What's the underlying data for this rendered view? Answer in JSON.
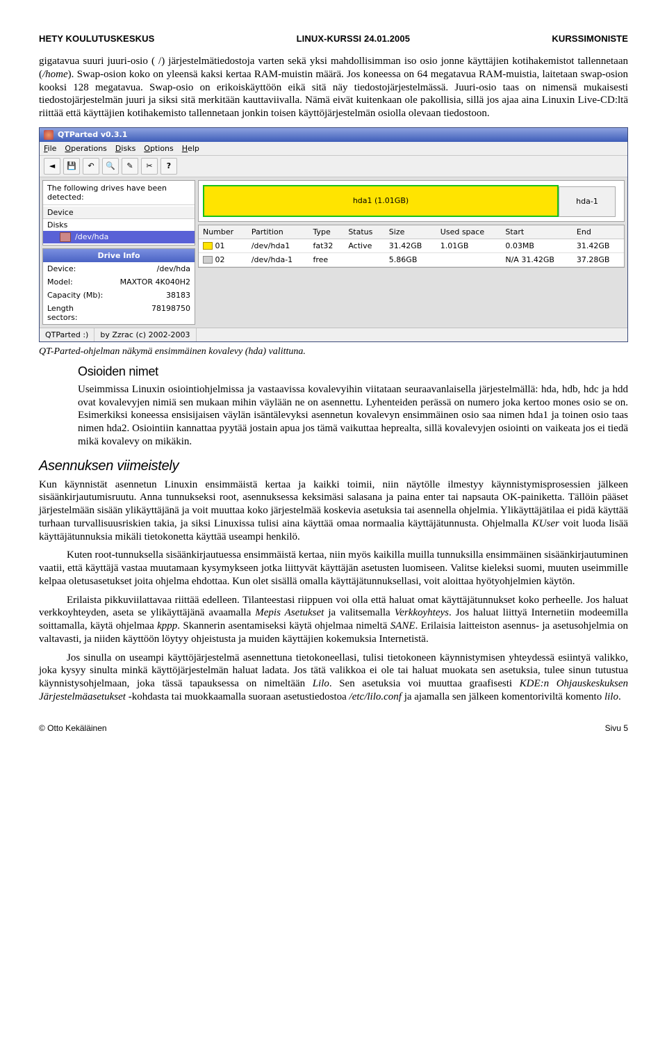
{
  "header": {
    "left": "HETY KOULUTUSKESKUS",
    "center": "LINUX-KURSSI 24.01.2005",
    "right": "KURSSIMONISTE"
  },
  "para1_html": "gigatavua suuri juuri-osio ( /) järjestelmätiedostoja varten sekä yksi mahdollisimman iso osio jonne käyttäjien kotihakemistot tallennetaan (<em>/home</em>). Swap-osion koko on yleensä kaksi kertaa RAM-muistin määrä. Jos koneessa on 64 megatavua RAM-muistia, laitetaan swap-osion kooksi 128 megatavua. Swap-osio on erikoiskäyttöön eikä sitä näy tiedostojärjestelmässä. Juuri-osio taas on nimensä mukaisesti tiedostojärjestelmän juuri ja siksi sitä merkitään kauttaviivalla. Nämä eivät kuitenkaan ole pakollisia, sillä jos ajaa aina Linuxin Live-CD:ltä riittää että käyttäjien kotihakemisto tallennetaan jonkin toisen käyttöjärjestelmän osiolla olevaan tiedostoon.",
  "screenshot": {
    "title": "QTParted v0.3.1",
    "menu": [
      "File",
      "Operations",
      "Disks",
      "Options",
      "Help"
    ],
    "toolbar_icons": [
      "arrow-left-icon",
      "save-icon",
      "undo-icon",
      "magnifier-icon",
      "pencil-icon",
      "cut-icon",
      "help-icon"
    ],
    "detect_label": "The following drives have been detected:",
    "tree_header": "Device",
    "tree_group": "Disks",
    "tree_item": "/dev/hda",
    "drive_info_title": "Drive Info",
    "drive_info": [
      {
        "k": "Device:",
        "v": "/dev/hda"
      },
      {
        "k": "Model:",
        "v": "MAXTOR 4K040H2"
      },
      {
        "k": "Capacity (Mb):",
        "v": "38183"
      },
      {
        "k": "Length sectors:",
        "v": "78198750"
      }
    ],
    "part_bar_label": "hda1 (1.01GB)",
    "part_bar_right": "hda-1",
    "table_headers": [
      "Number",
      "Partition",
      "Type",
      "Status",
      "Size",
      "Used space",
      "Start",
      "End"
    ],
    "table_rows": [
      {
        "icon": "flag-fat",
        "cells": [
          "01",
          "/dev/hda1",
          "fat32",
          "Active",
          "31.42GB",
          "1.01GB",
          "0.03MB",
          "31.42GB"
        ]
      },
      {
        "icon": "flag-free",
        "cells": [
          "02",
          "/dev/hda-1",
          "free",
          "",
          "5.86GB",
          "",
          "N/A 31.42GB",
          "37.28GB"
        ]
      }
    ],
    "statusbar": [
      "QTParted :)",
      "by Zzrac (c) 2002-2003"
    ]
  },
  "caption": "QT-Parted-ohjelman näkymä ensimmäinen kovalevy (hda) valittuna.",
  "sub1": "Osioiden nimet",
  "sub1_body": "Useimmissa Linuxin osiointiohjelmissa ja vastaavissa kovalevyihin viitataan seuraavanlaisella järjestelmällä: hda, hdb, hdc ja hdd ovat kovalevyjen nimiä sen mukaan mihin väylään ne on asennettu. Lyhenteiden perässä on numero joka kertoo mones osio se on. Esimerkiksi koneessa ensisijaisen väylän isäntälevyksi asennetun kovalevyn ensimmäinen osio saa nimen hda1 ja toinen osio taas nimen hda2. Osiointiin kannattaa pyytää jostain apua jos tämä vaikuttaa heprealta, sillä kovalevyjen osiointi on vaikeata jos ei tiedä mikä kovalevy on mikäkin.",
  "sec2": "Asennuksen viimeistely",
  "sec2_p1_html": "Kun käynnistät asennetun Linuxin ensimmäistä kertaa ja kaikki toimii, niin näytölle ilmestyy käynnistymisprosessien jälkeen sisäänkirjautumisruutu. Anna tunnukseksi root, asennuksessa keksimäsi salasana ja paina enter tai napsauta OK-painiketta. Tällöin pääset järjestelmään sisään ylikäyttäjänä ja voit muuttaa koko järjestelmää koskevia asetuksia tai asennella ohjelmia. Ylikäyttäjätilaa ei pidä käyttää turhaan turvallisuusriskien takia, ja siksi Linuxissa tulisi aina käyttää omaa normaalia käyttäjätunnusta. Ohjelmalla <em>KUser</em> voit luoda lisää käyttäjätunnuksia mikäli tietokonetta käyttää useampi henkilö.",
  "sec2_p2": "Kuten root-tunnuksella sisäänkirjautuessa ensimmäistä kertaa, niin myös kaikilla muilla tunnuksilla ensimmäinen sisäänkirjautuminen vaatii, että käyttäjä vastaa muutamaan kysymykseen jotka liittyvät käyttäjän asetusten luomiseen. Valitse kieleksi suomi, muuten useimmille kelpaa oletusasetukset joita ohjelma ehdottaa. Kun olet sisällä omalla käyttäjätunnuksellasi, voit aloittaa hyötyohjelmien käytön.",
  "sec2_p3_html": "Erilaista pikkuviilattavaa riittää edelleen. Tilanteestasi riippuen voi olla että haluat omat käyttäjätunnukset koko perheelle. Jos haluat verkkoyhteyden, aseta se ylikäyttäjänä avaamalla <em>Mepis Asetukset</em> ja valitsemalla <em>Verkkoyhteys</em>. Jos haluat liittyä Internetiin modeemilla soittamalla, käytä ohjelmaa <em>kppp</em>. Skannerin asentamiseksi käytä ohjelmaa nimeltä <em>SANE</em>. Erilaisia laitteiston asennus- ja asetusohjelmia on valtavasti, ja niiden käyttöön löytyy ohjeistusta ja muiden käyttäjien kokemuksia Internetistä.",
  "sec2_p4_html": "Jos sinulla on useampi käyttöjärjestelmä asennettuna tietokoneellasi, tulisi tietokoneen käynnistymisen yhteydessä esiintyä valikko, joka kysyy sinulta minkä käyttöjärjestelmän haluat ladata. Jos tätä valikkoa ei ole tai haluat muokata sen asetuksia, tulee sinun tutustua käynnistysohjelmaan, joka tässä tapauksessa on nimeltään <em>Lilo</em>. Sen asetuksia voi muuttaa graafisesti <em>KDE:n Ohjauskeskuksen Järjestelmäasetukset</em> -kohdasta tai muokkaamalla suoraan asetustiedostoa <em>/etc/lilo.conf</em> ja ajamalla sen jälkeen komentoriviltä komento <em>lilo</em>.",
  "footer": {
    "left": "© Otto Kekäläinen",
    "right": "Sivu 5"
  }
}
